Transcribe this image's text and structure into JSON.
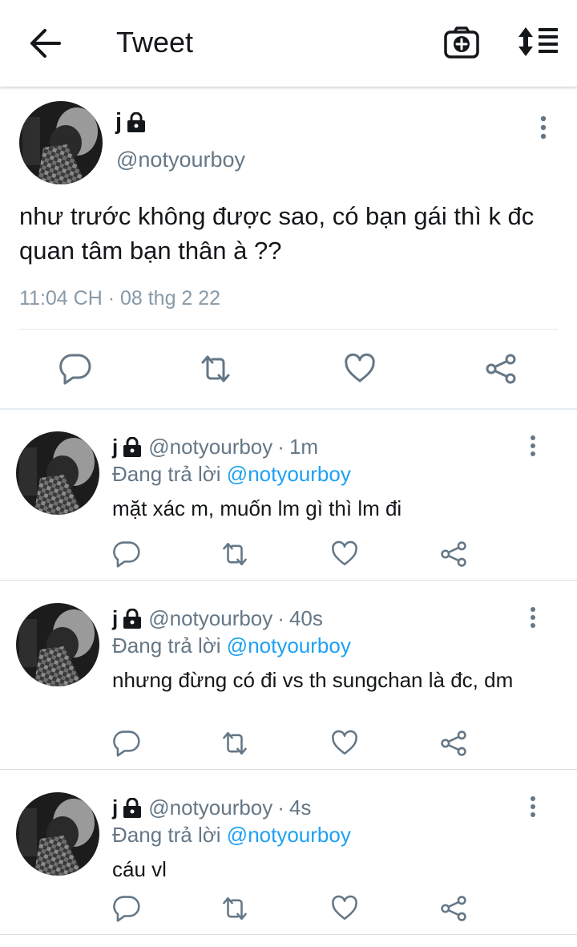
{
  "header": {
    "title": "Tweet",
    "back_icon": "back-arrow-icon",
    "camera_icon": "camera-add-icon",
    "sort_icon": "sort-list-icon"
  },
  "main_tweet": {
    "name": "j",
    "protected_icon": "lock-icon",
    "handle": "@notyourboy",
    "text": "như trước không được sao, có bạn gái thì k đc quan tâm bạn thân à ??",
    "timestamp": "11:04 CH · 08 thg 2 22",
    "actions": [
      "reply-icon",
      "retweet-icon",
      "like-icon",
      "share-icon"
    ]
  },
  "replies": [
    {
      "name": "j",
      "handle": "@notyourboy",
      "separator": "·",
      "time": "1m",
      "replying_prefix": "Đang trả lời",
      "replying_to": "@notyourboy",
      "text": "mặt xác m, muốn lm gì thì lm đi"
    },
    {
      "name": "j",
      "handle": "@notyourboy",
      "separator": "·",
      "time": "40s",
      "replying_prefix": "Đang trả lời",
      "replying_to": "@notyourboy",
      "text": "nhưng đừng có đi vs th sungchan là đc, dm"
    },
    {
      "name": "j",
      "handle": "@notyourboy",
      "separator": "·",
      "time": "4s",
      "replying_prefix": "Đang trả lời",
      "replying_to": "@notyourboy",
      "text": "cáu vl"
    }
  ],
  "colors": {
    "text": "#14171a",
    "secondary": "#657786",
    "timestamp": "#8899a6",
    "link": "#1da1f2",
    "icon": "#657786"
  }
}
